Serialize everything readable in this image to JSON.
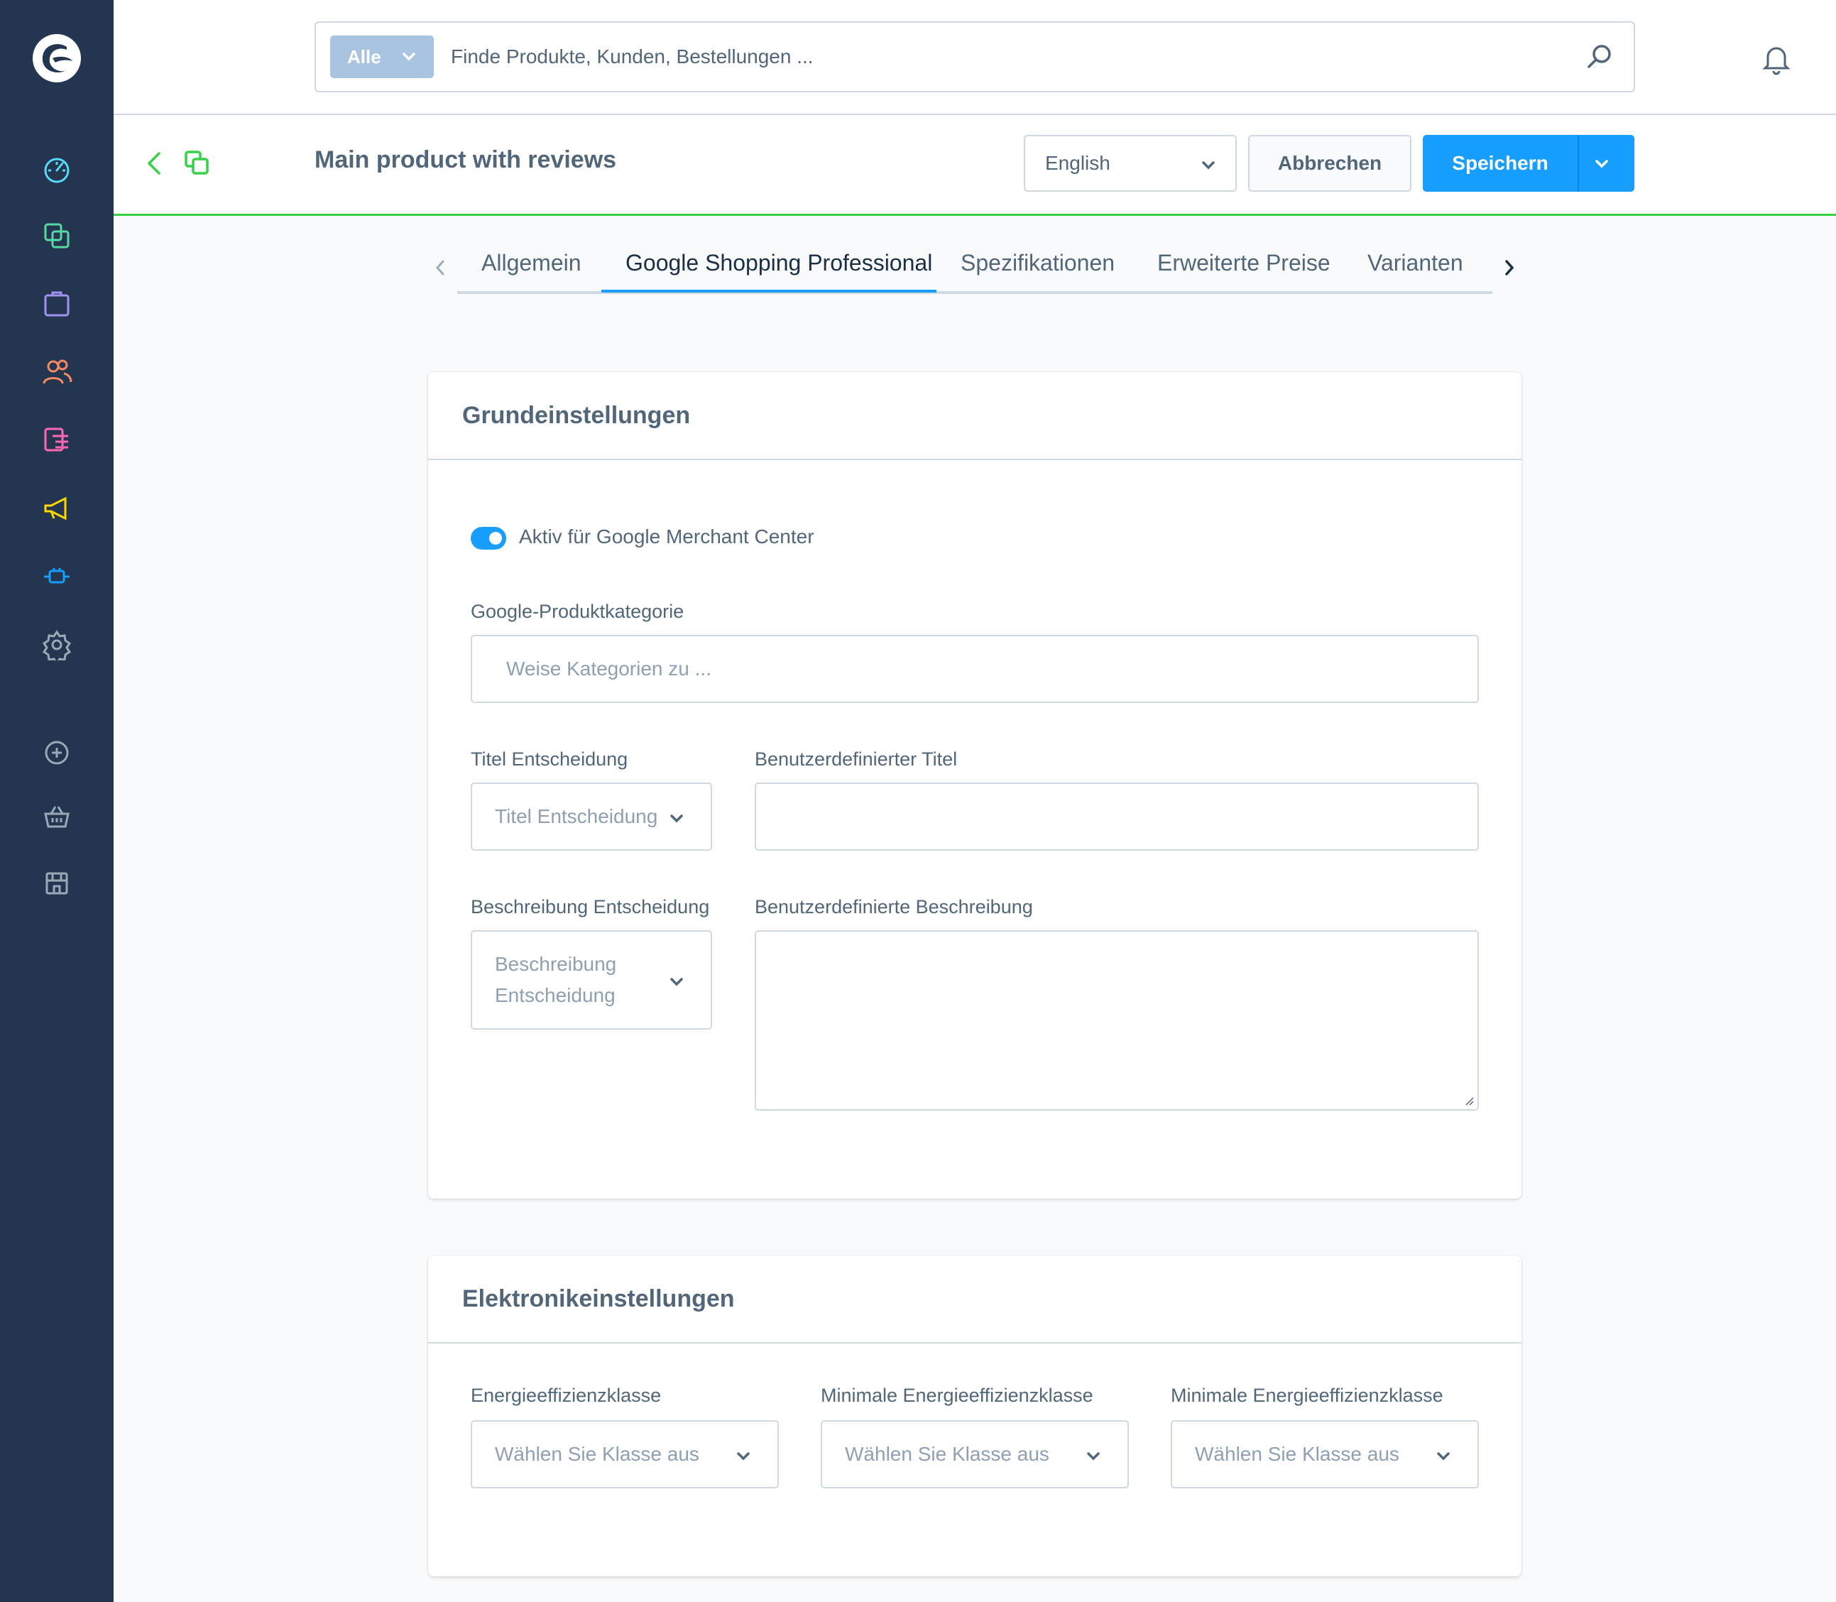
{
  "search": {
    "type_label": "Alle",
    "placeholder": "Finde Produkte, Kunden, Bestellungen ..."
  },
  "sidebar": {
    "items": [
      {
        "icon": "dashboard-icon",
        "color": "#57d9f8"
      },
      {
        "icon": "catalog-icon",
        "color": "#57d9a3"
      },
      {
        "icon": "orders-icon",
        "color": "#a092f0"
      },
      {
        "icon": "customers-icon",
        "color": "#f88962"
      },
      {
        "icon": "content-icon",
        "color": "#ff68b4"
      },
      {
        "icon": "marketing-icon",
        "color": "#ffd700"
      },
      {
        "icon": "extensions-icon",
        "color": "#189eff"
      },
      {
        "icon": "settings-icon",
        "color": "#9aa8b5"
      },
      {
        "icon": "add-icon",
        "color": "#9aa8b5"
      },
      {
        "icon": "basket-icon",
        "color": "#9aa8b5"
      },
      {
        "icon": "store-icon",
        "color": "#9aa8b5"
      }
    ]
  },
  "smartbar": {
    "title": "Main product with reviews",
    "language": "English",
    "cancel_label": "Abbrechen",
    "save_label": "Speichern"
  },
  "tabs": [
    {
      "label": "Allgemein",
      "active": false
    },
    {
      "label": "Google Shopping Professional",
      "active": true
    },
    {
      "label": "Spezifikationen",
      "active": false
    },
    {
      "label": "Erweiterte Preise",
      "active": false
    },
    {
      "label": "Varianten",
      "active": false
    }
  ],
  "basic_settings": {
    "title": "Grundeinstellungen",
    "active_toggle_label": "Aktiv für Google Merchant Center",
    "active_toggle_value": true,
    "category_label": "Google-Produktkategorie",
    "category_placeholder": "Weise Kategorien zu ...",
    "title_decision_label": "Titel Entscheidung",
    "title_decision_placeholder": "Titel Entscheidung",
    "custom_title_label": "Benutzerdefinierter Titel",
    "custom_title_value": "",
    "description_decision_label": "Beschreibung Entscheidung",
    "description_decision_placeholder_line1": "Beschreibung",
    "description_decision_placeholder_line2": "Entscheidung",
    "custom_description_label": "Benutzerdefinierte Beschreibung",
    "custom_description_value": ""
  },
  "electronics_settings": {
    "title": "Elektronikeinstellungen",
    "energy_class_label": "Energieeffizienzklasse",
    "energy_class_placeholder": "Wählen Sie Klasse aus",
    "min_energy_class_label": "Minimale Energieeffizienzklasse",
    "min_energy_class_placeholder": "Wählen Sie Klasse aus",
    "max_energy_class_label": "Minimale Energieeffizienzklasse",
    "max_energy_class_placeholder": "Wählen Sie Klasse aus"
  },
  "colors": {
    "sidebar_bg": "#243550",
    "accent": "#189eff",
    "smartbar_border": "#37d046"
  }
}
